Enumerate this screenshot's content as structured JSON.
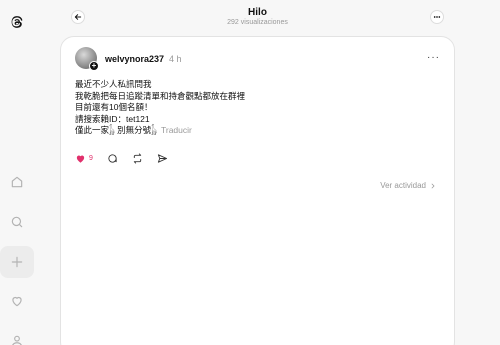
{
  "header": {
    "title": "Hilo",
    "views": "292 visualizaciones"
  },
  "post": {
    "username": "welvynora237",
    "time": "4 h",
    "lines": [
      "最近不少人私訊問我",
      "我乾脆把每日追蹤清單和持倉觀點都放在群裡",
      "目前還有10個名額！",
      "請搜索賴ID：tet121",
      "僅此一家𓃱 別無分號𓃱"
    ],
    "translate": "Traducir",
    "likes": "9"
  },
  "activity": {
    "label": "Ver actividad"
  },
  "colors": {
    "like": "#e1306c",
    "muted": "#999999",
    "background": "#f7f7f7"
  }
}
